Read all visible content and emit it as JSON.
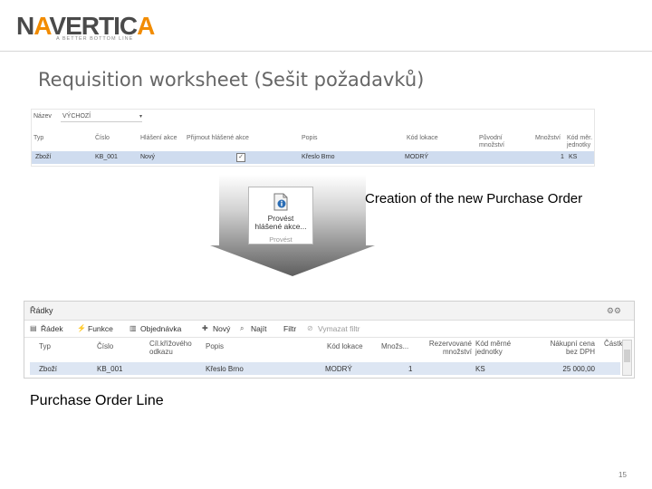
{
  "logo": {
    "main": "NAVERTICA",
    "tagline": "A BETTER BOTTOM LINE"
  },
  "slide_title": "Requisition worksheet (Sešit požadavků)",
  "worksheet": {
    "name_label": "Název",
    "name_value": "VÝCHOZÍ",
    "columns": [
      "Typ",
      "Číslo",
      "Hlášení akce",
      "Přijmout hlášené akce",
      "Popis",
      "Kód lokace",
      "Původní množství",
      "Množství",
      "Kód měr. jednotky"
    ],
    "row": {
      "typ": "Zboží",
      "cislo": "KB_001",
      "akce": "Nový",
      "prijmout": "✓",
      "popis": "Křeslo Brno",
      "lokace": "MODRÝ",
      "mnozstvi": "1",
      "jednotka": "KS"
    }
  },
  "action_button": {
    "line1": "Provést",
    "line2": "hlášené akce...",
    "group": "Provést",
    "icon": "document-run-icon"
  },
  "creation_caption": "Creation of the new Purchase Order",
  "lines": {
    "title": "Řádky",
    "toolbar": [
      "Řádek",
      "Funkce",
      "Objednávka",
      "Nový",
      "Najít",
      "Filtr",
      "Vymazat filtr"
    ],
    "columns": [
      "Typ",
      "Číslo",
      "Cíl.křížového odkazu",
      "Popis",
      "Kód lokace",
      "Množs...",
      "Rezervované množství",
      "Kód měrné jednotky",
      "Nákupní cena bez DPH",
      "Částk"
    ],
    "row": {
      "typ": "Zboží",
      "cislo": "KB_001",
      "popis": "Křeslo Brno",
      "lokace": "MODRÝ",
      "mnozstvi": "1",
      "jednotka": "KS",
      "cena": "25 000,00"
    }
  },
  "purchase_caption": "Purchase Order Line",
  "page_number": "15",
  "colors": {
    "arrow": "#6e6e6e",
    "row_selected": "#cfdcef",
    "accent_orange": "#f28c00"
  }
}
